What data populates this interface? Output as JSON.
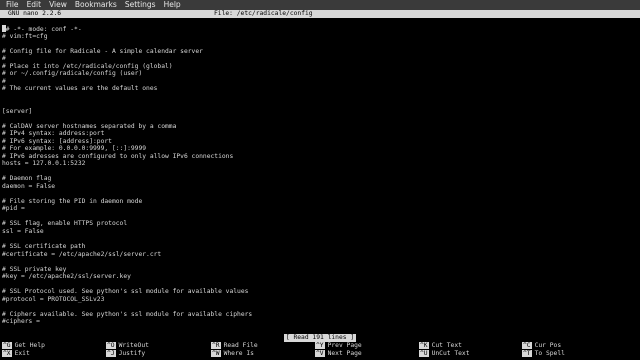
{
  "menubar": {
    "items": [
      "File",
      "Edit",
      "View",
      "Bookmarks",
      "Settings",
      "Help"
    ]
  },
  "nano": {
    "version": "GNU nano 2.2.6",
    "file_title": "File: /etc/radicale/config",
    "status": "[ Read 191 lines ]"
  },
  "lines": [
    "# -*- mode: conf -*-",
    "# vim:ft=cfg",
    "",
    "# Config file for Radicale - A simple calendar server",
    "#",
    "# Place it into /etc/radicale/config (global)",
    "# or ~/.config/radicale/config (user)",
    "#",
    "# The current values are the default ones",
    "",
    "",
    "[server]",
    "",
    "# CalDAV server hostnames separated by a comma",
    "# IPv4 syntax: address:port",
    "# IPv6 syntax: [address]:port",
    "# For example: 0.0.0.0:9999, [::]:9999",
    "# IPv6 adresses are configured to only allow IPv6 connections",
    "hosts = 127.0.0.1:5232",
    "",
    "# Daemon flag",
    "daemon = False",
    "",
    "# File storing the PID in daemon mode",
    "#pid =",
    "",
    "# SSL flag, enable HTTPS protocol",
    "ssl = False",
    "",
    "# SSL certificate path",
    "#certificate = /etc/apache2/ssl/server.crt",
    "",
    "# SSL private key",
    "#key = /etc/apache2/ssl/server.key",
    "",
    "# SSL Protocol used. See python's ssl module for available values",
    "#protocol = PROTOCOL_SSLv23",
    "",
    "# Ciphers available. See python's ssl module for available ciphers",
    "#ciphers ="
  ],
  "shortcuts": {
    "row1": [
      {
        "key": "^G",
        "label": "Get Help"
      },
      {
        "key": "^O",
        "label": "WriteOut"
      },
      {
        "key": "^R",
        "label": "Read File"
      },
      {
        "key": "^Y",
        "label": "Prev Page"
      },
      {
        "key": "^K",
        "label": "Cut Text"
      },
      {
        "key": "^C",
        "label": "Cur Pos"
      }
    ],
    "row2": [
      {
        "key": "^X",
        "label": "Exit"
      },
      {
        "key": "^J",
        "label": "Justify"
      },
      {
        "key": "^W",
        "label": "Where Is"
      },
      {
        "key": "^V",
        "label": "Next Page"
      },
      {
        "key": "^U",
        "label": "UnCut Text"
      },
      {
        "key": "^T",
        "label": "To Spell"
      }
    ]
  }
}
